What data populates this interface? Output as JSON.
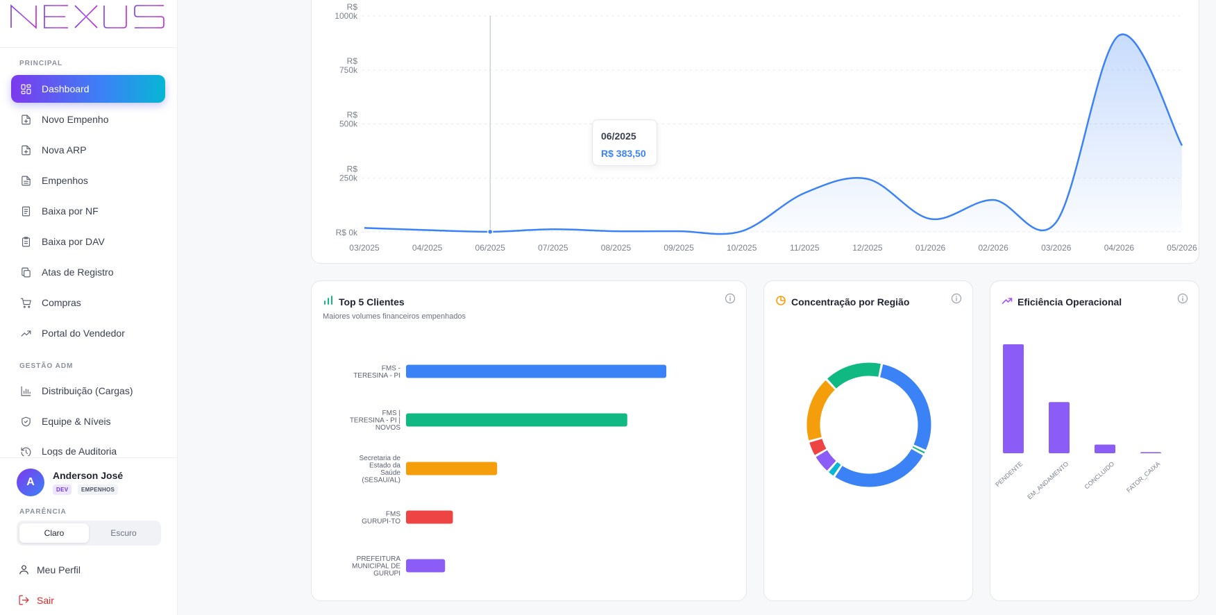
{
  "app": {
    "logo_text": "NEXUS"
  },
  "sidebar": {
    "section_principal": "PRINCIPAL",
    "section_gestao": "GESTÃO ADM",
    "items": [
      {
        "label": "Dashboard",
        "icon": "grid-icon"
      },
      {
        "label": "Novo Empenho",
        "icon": "file-plus-icon"
      },
      {
        "label": "Nova ARP",
        "icon": "file-plus-icon"
      },
      {
        "label": "Empenhos",
        "icon": "file-text-icon"
      },
      {
        "label": "Baixa por NF",
        "icon": "receipt-icon"
      },
      {
        "label": "Baixa por DAV",
        "icon": "clipboard-icon"
      },
      {
        "label": "Atas de Registro",
        "icon": "copy-icon"
      },
      {
        "label": "Compras",
        "icon": "cart-icon"
      },
      {
        "label": "Portal do Vendedor",
        "icon": "trending-up-icon"
      },
      {
        "label": "Distribuição (Cargas)",
        "icon": "bar-chart-icon"
      },
      {
        "label": "Equipe & Níveis",
        "icon": "shield-icon"
      },
      {
        "label": "Logs de Auditoria",
        "icon": "history-icon"
      }
    ],
    "user": {
      "initial": "A",
      "name": "Anderson José",
      "badge_role": "DEV",
      "badge_dept": "EMPENHOS"
    },
    "appearance": {
      "label": "APARÊNCIA",
      "light": "Claro",
      "dark": "Escuro",
      "selected": "Claro"
    },
    "profile_label": "Meu Perfil",
    "logout_label": "Sair"
  },
  "colors": {
    "accent_purple": "#7c3aed",
    "accent_blue": "#3b82f6",
    "accent_cyan": "#06b6d4",
    "logout_red": "#dc2626"
  },
  "tooltip": {
    "date": "06/2025",
    "value": "R$ 383,50"
  },
  "top_clients": {
    "title": "Top 5 Clientes",
    "subtitle": "Maiores volumes financeiros empenhados"
  },
  "region": {
    "title": "Concentração por Região"
  },
  "efficiency": {
    "title": "Eficiência Operacional"
  },
  "chart_data": [
    {
      "type": "area",
      "x": [
        "03/2025",
        "04/2025",
        "06/2025",
        "07/2025",
        "08/2025",
        "09/2025",
        "10/2025",
        "11/2025",
        "12/2025",
        "01/2026",
        "02/2026",
        "03/2026",
        "04/2026",
        "05/2026"
      ],
      "y_tick_labels": [
        {
          "top": "R$",
          "bottom": "1000k"
        },
        {
          "top": "R$",
          "bottom": "750k"
        },
        {
          "top": "R$",
          "bottom": "500k"
        },
        {
          "top": "R$",
          "bottom": "250k"
        },
        {
          "top": "",
          "bottom": "R$ 0k"
        }
      ],
      "ylim": [
        0,
        1000000
      ],
      "series": [
        {
          "values": [
            18000,
            8000,
            383.5,
            12000,
            3000,
            3000,
            3000,
            180000,
            245000,
            60000,
            148000,
            45000,
            910000,
            400000
          ],
          "color": "#3b82f6"
        }
      ],
      "grid": true
    },
    {
      "type": "bar",
      "orientation": "horizontal",
      "categories": [
        "FMS - TERESINA - PI",
        "FMS | TERESINA - PI | NOVOS",
        "Secretaria de Estado da Saúde (SESAU/AL)",
        "FMS GURUPI-TO",
        "PREFEITURA MUNICIPAL DE GURUPI"
      ],
      "category_lines": [
        [
          "FMS -",
          "TERESINA - PI"
        ],
        [
          "FMS |",
          "TERESINA - PI |",
          "NOVOS"
        ],
        [
          "Secretaria de",
          "Estado da",
          "Saúde",
          "(SESAU/AL)"
        ],
        [
          "FMS",
          "GURUPI-TO"
        ],
        [
          "PREFEITURA",
          "MUNICIPAL DE",
          "GURUPI"
        ]
      ],
      "values": [
        100,
        85,
        35,
        18,
        15
      ],
      "colors": [
        "#3b82f6",
        "#10b981",
        "#f59e0b",
        "#ef4444",
        "#8b5cf6"
      ]
    },
    {
      "type": "pie",
      "donut": true,
      "values": [
        28,
        1,
        26,
        2,
        5,
        4,
        17,
        15
      ],
      "colors": [
        "#3b82f6",
        "#10b981",
        "#3b82f6",
        "#06b6d4",
        "#8b5cf6",
        "#ef4444",
        "#f59e0b",
        "#10b981"
      ]
    },
    {
      "type": "bar",
      "categories": [
        "PENDENTE",
        "EM_ANDAMENTO",
        "CONCLUIDO",
        "FATOR_CAIXA"
      ],
      "values": [
        100,
        47,
        8,
        1
      ],
      "color": "#8b5cf6"
    }
  ]
}
